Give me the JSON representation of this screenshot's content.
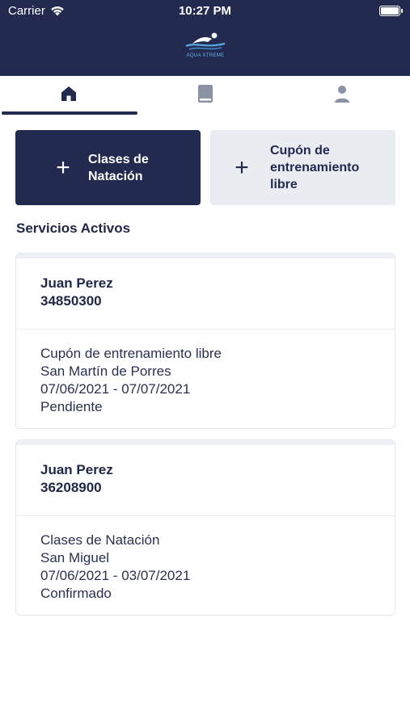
{
  "status_bar": {
    "carrier": "Carrier",
    "time": "10:27 PM"
  },
  "brand": {
    "logo_text": "AQUA XTREME"
  },
  "tabs": [
    {
      "name": "home",
      "icon": "home-icon",
      "active": true
    },
    {
      "name": "book",
      "icon": "book-icon",
      "active": false
    },
    {
      "name": "profile",
      "icon": "user-icon",
      "active": false
    }
  ],
  "actions": {
    "swim_classes_label": "Clases de Natación",
    "free_training_label": "Cupón de entrenamiento libre"
  },
  "section_title": "Servicios Activos",
  "services": [
    {
      "name": "Juan Perez",
      "doc": "34850300",
      "service": "Cupón de entrenamiento libre",
      "location": "San Martín de Porres",
      "dates": "07/06/2021 - 07/07/2021",
      "status": "Pendiente"
    },
    {
      "name": "Juan Perez",
      "doc": "36208900",
      "service": "Clases de Natación",
      "location": "San Miguel",
      "dates": "07/06/2021 - 03/07/2021",
      "status": "Confirmado"
    }
  ],
  "colors": {
    "navy": "#232a4f",
    "light_button": "#e9ecf1",
    "icon_gray": "#8a93a6"
  }
}
